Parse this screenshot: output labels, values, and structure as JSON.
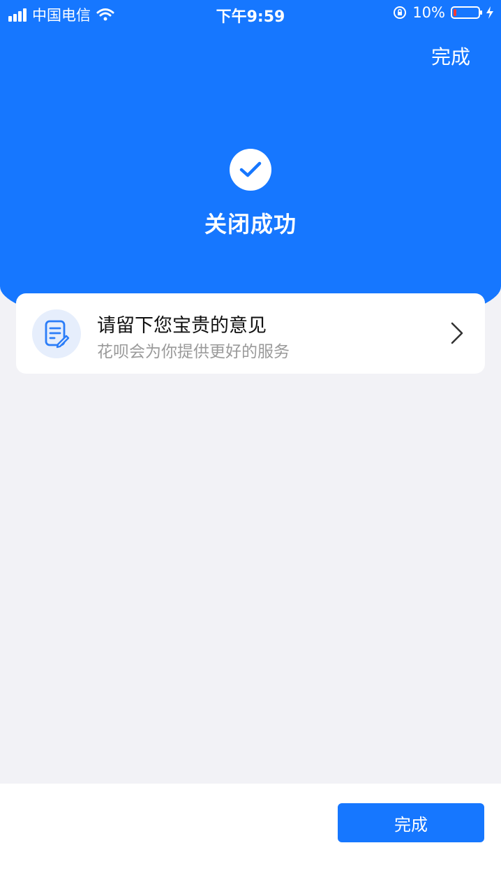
{
  "status_bar": {
    "carrier": "中国电信",
    "time": "下午9:59",
    "battery_percent": "10%",
    "battery_level": 0.1
  },
  "header": {
    "done_label": "完成"
  },
  "result": {
    "title": "关闭成功",
    "icon": "check-icon"
  },
  "feedback": {
    "title": "请留下您宝贵的意见",
    "subtitle": "花呗会为你提供更好的服务",
    "icon": "edit-document-icon"
  },
  "footer": {
    "done_label": "完成"
  },
  "colors": {
    "brand": "#1677ff",
    "background": "#f2f2f6"
  }
}
